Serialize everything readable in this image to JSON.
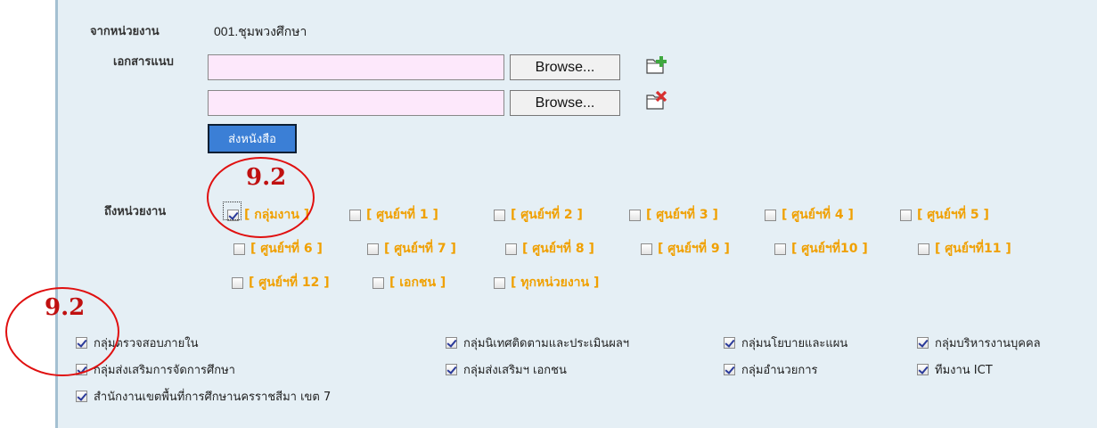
{
  "form": {
    "from_label": "จากหน่วยงาน",
    "from_value": "001.ชุมพวงศึกษา",
    "attach_label": "เอกสารแนบ",
    "browse_label": "Browse...",
    "send_label": "ส่งหนังสือ",
    "to_label": "ถึงหน่วยงาน"
  },
  "recipients": [
    {
      "label": "[ กลุ่มงาน ]",
      "checked": true
    },
    {
      "label": "[ ศูนย์ฯที่ 1 ]",
      "checked": false
    },
    {
      "label": "[ ศูนย์ฯที่ 2 ]",
      "checked": false
    },
    {
      "label": "[ ศูนย์ฯที่ 3 ]",
      "checked": false
    },
    {
      "label": "[ ศูนย์ฯที่ 4 ]",
      "checked": false
    },
    {
      "label": "[ ศูนย์ฯที่ 5 ]",
      "checked": false
    },
    {
      "label": "[ ศูนย์ฯที่ 6 ]",
      "checked": false
    },
    {
      "label": "[ ศูนย์ฯที่ 7 ]",
      "checked": false
    },
    {
      "label": "[ ศูนย์ฯที่ 8 ]",
      "checked": false
    },
    {
      "label": "[ ศูนย์ฯที่ 9 ]",
      "checked": false
    },
    {
      "label": "[ ศูนย์ฯที่10 ]",
      "checked": false
    },
    {
      "label": "[ ศูนย์ฯที่11 ]",
      "checked": false
    },
    {
      "label": "[ ศูนย์ฯที่ 12 ]",
      "checked": false
    },
    {
      "label": "[ เอกชน ]",
      "checked": false
    },
    {
      "label": "[ ทุกหน่วยงาน ]",
      "checked": false
    }
  ],
  "groups": [
    {
      "label": "กลุ่มตรวจสอบภายใน",
      "checked": true
    },
    {
      "label": "กลุ่มนิเทศติดตามและประเมินผลฯ",
      "checked": true
    },
    {
      "label": "กลุ่มนโยบายและแผน",
      "checked": true
    },
    {
      "label": "กลุ่มบริหารงานบุคคล",
      "checked": true
    },
    {
      "label": "กลุ่มส่งเสริมการจัดการศึกษา",
      "checked": true
    },
    {
      "label": "กลุ่มส่งเสริมฯ เอกชน",
      "checked": true
    },
    {
      "label": "กลุ่มอำนวยการ",
      "checked": true
    },
    {
      "label": "ทีมงาน ICT",
      "checked": true
    },
    {
      "label": "สำนักงานเขตพื้นที่การศึกษานครราชสีมา เขต 7",
      "checked": true
    }
  ],
  "annotations": {
    "top": "9.2",
    "bottom": "9.2",
    "color": "#e01010"
  },
  "icons": [
    "add-file-icon",
    "remove-file-icon"
  ]
}
